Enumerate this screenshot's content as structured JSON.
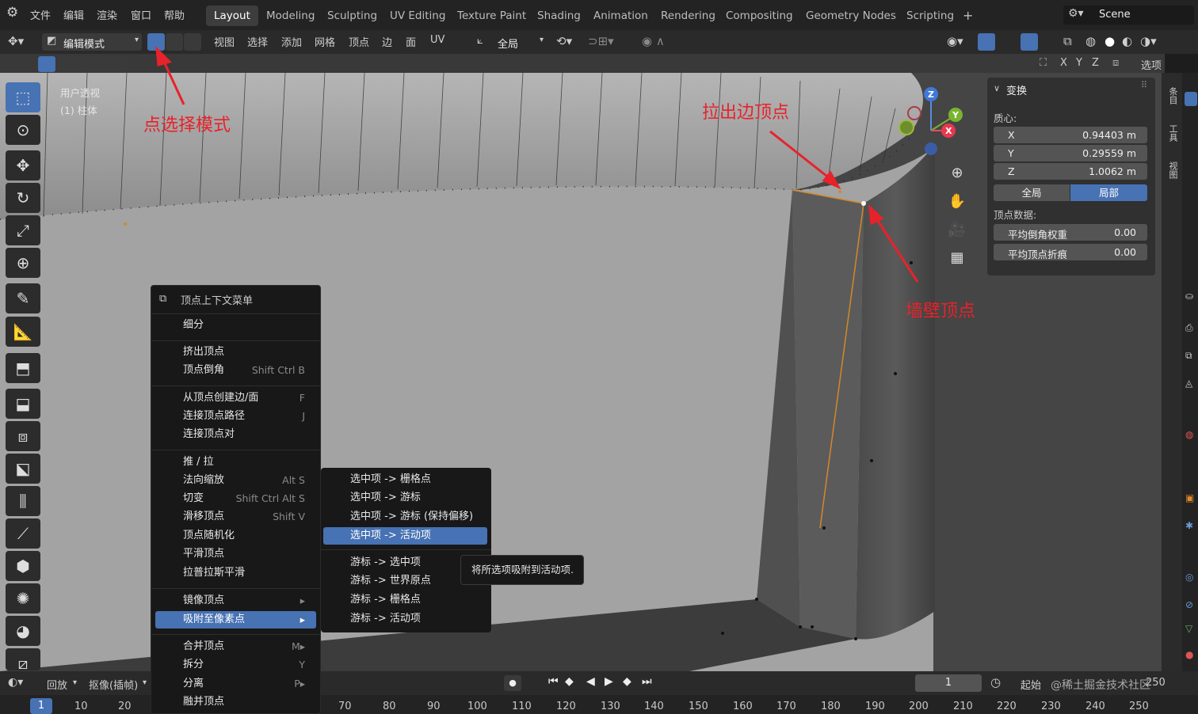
{
  "topbar": {
    "menus": [
      "文件",
      "编辑",
      "渲染",
      "窗口",
      "帮助"
    ],
    "workspaces": [
      "Layout",
      "Modeling",
      "Sculpting",
      "UV Editing",
      "Texture Paint",
      "Shading",
      "Animation",
      "Rendering",
      "Compositing",
      "Geometry Nodes",
      "Scripting"
    ],
    "active_workspace": "Layout",
    "add_tab": "+",
    "scene": "Scene"
  },
  "header": {
    "mode": "编辑模式",
    "menus": [
      "视图",
      "选择",
      "添加",
      "网格",
      "顶点",
      "边",
      "面",
      "UV"
    ],
    "transform_orientation": "全局",
    "options": "选项",
    "axes": [
      "X",
      "Y",
      "Z"
    ]
  },
  "viewport": {
    "view_name": "用户透视",
    "object_name": "(1) 柱体"
  },
  "annotations": {
    "select_mode": "点选择模式",
    "extrude_vertex": "拉出边顶点",
    "wall_vertex": "墙壁顶点"
  },
  "gizmo": {
    "z": "Z",
    "y": "Y",
    "x": "X"
  },
  "npanel": {
    "section": "变换",
    "median_label": "质心:",
    "x_label": "X",
    "x_value": "0.94403 m",
    "y_label": "Y",
    "y_value": "0.29559 m",
    "z_label": "Z",
    "z_value": "1.0062 m",
    "global": "全局",
    "local": "局部",
    "vertex_data": "顶点数据:",
    "bevel_weight_label": "平均倒角权重",
    "bevel_weight_value": "0.00",
    "crease_label": "平均顶点折痕",
    "crease_value": "0.00"
  },
  "rtabs": [
    "条目",
    "工具",
    "视图"
  ],
  "menu": {
    "title": "顶点上下文菜单",
    "items": [
      {
        "label": "细分",
        "shortcut": ""
      },
      {
        "label": "挤出顶点",
        "shortcut": ""
      },
      {
        "label": "顶点倒角",
        "shortcut": "Shift Ctrl B"
      },
      {
        "label": "从顶点创建边/面",
        "shortcut": "F"
      },
      {
        "label": "连接顶点路径",
        "shortcut": "J"
      },
      {
        "label": "连接顶点对",
        "shortcut": ""
      },
      {
        "label": "推 / 拉",
        "shortcut": ""
      },
      {
        "label": "法向缩放",
        "shortcut": "Alt S"
      },
      {
        "label": "切变",
        "shortcut": "Shift Ctrl Alt S"
      },
      {
        "label": "滑移顶点",
        "shortcut": "Shift V"
      },
      {
        "label": "顶点随机化",
        "shortcut": ""
      },
      {
        "label": "平滑顶点",
        "shortcut": ""
      },
      {
        "label": "拉普拉斯平滑",
        "shortcut": ""
      },
      {
        "label": "镜像顶点",
        "shortcut": "▸"
      },
      {
        "label": "吸附至像素点",
        "shortcut": "▸"
      },
      {
        "label": "合并顶点",
        "shortcut": "M▸"
      },
      {
        "label": "拆分",
        "shortcut": "Y"
      },
      {
        "label": "分离",
        "shortcut": "P▸"
      },
      {
        "label": "融并顶点",
        "shortcut": ""
      }
    ]
  },
  "submenu": {
    "items": [
      "选中项 -> 栅格点",
      "选中项 -> 游标",
      "选中项 -> 游标 (保持偏移)",
      "选中项 -> 活动项",
      "游标 -> 选中项",
      "游标 -> 世界原点",
      "游标 -> 栅格点",
      "游标 -> 活动项"
    ],
    "highlighted": "选中项 -> 活动项"
  },
  "tooltip": "将所选项吸附到活动项.",
  "timeline": {
    "playback": "回放",
    "keying": "抠像(插帧)",
    "frame": "1",
    "start_label": "起始",
    "watermark": "@稀土掘金技术社区",
    "end_value": "250",
    "current": "1",
    "ticks": [
      "10",
      "20",
      "70",
      "80",
      "90",
      "100",
      "110",
      "120",
      "130",
      "140",
      "150",
      "160",
      "170",
      "180",
      "190",
      "200",
      "210",
      "220",
      "230",
      "240",
      "250"
    ]
  }
}
